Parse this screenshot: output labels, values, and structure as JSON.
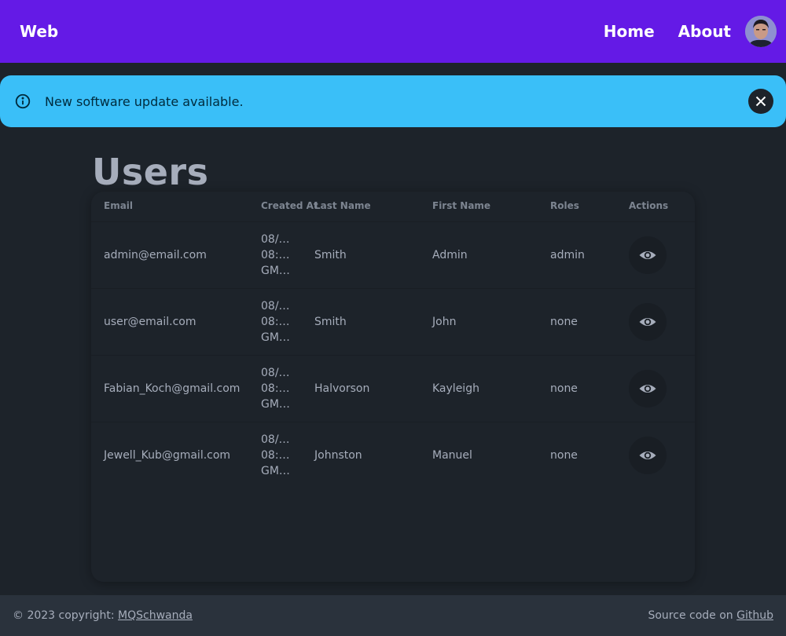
{
  "navbar": {
    "brand": "Web",
    "links": [
      {
        "label": "Home"
      },
      {
        "label": "About"
      }
    ],
    "background": "#641ae6"
  },
  "alert": {
    "message": "New software update available.",
    "icon": "info-icon",
    "color": "#3abff8"
  },
  "page": {
    "title": "Users"
  },
  "table": {
    "columns": [
      "Email",
      "Created At",
      "Last Name",
      "First Name",
      "Roles",
      "Actions"
    ],
    "rows": [
      {
        "email": "admin@email.com",
        "created": [
          "08/…",
          "08:…",
          "GM…"
        ],
        "last_name": "Smith",
        "first_name": "Admin",
        "roles": "admin",
        "action_icon": "eye-icon"
      },
      {
        "email": "user@email.com",
        "created": [
          "08/…",
          "08:…",
          "GM…"
        ],
        "last_name": "Smith",
        "first_name": "John",
        "roles": "none",
        "action_icon": "eye-icon"
      },
      {
        "email": "Fabian_Koch@gmail.com",
        "created": [
          "08/…",
          "08:…",
          "GM…"
        ],
        "last_name": "Halvorson",
        "first_name": "Kayleigh",
        "roles": "none",
        "action_icon": "eye-icon"
      },
      {
        "email": "Jewell_Kub@gmail.com",
        "created": [
          "08/…",
          "08:…",
          "GM…"
        ],
        "last_name": "Johnston",
        "first_name": "Manuel",
        "roles": "none",
        "action_icon": "eye-icon"
      }
    ]
  },
  "footer": {
    "copyright_prefix": "© 2023 copyright: ",
    "copyright_link": "MQSchwanda",
    "source_prefix": "Source code on ",
    "source_link": "Github"
  }
}
